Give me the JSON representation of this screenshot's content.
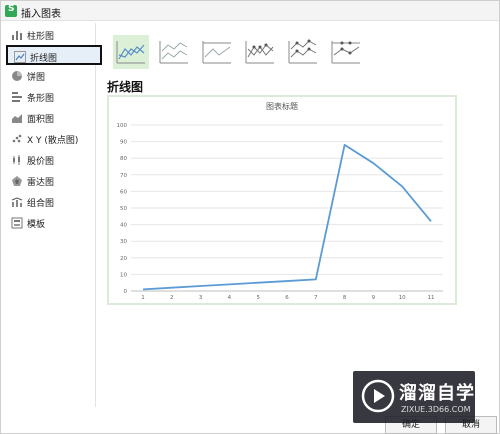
{
  "window": {
    "title": "插入图表"
  },
  "sidebar": {
    "items": [
      {
        "label": "柱形图",
        "icon": "column-chart-icon"
      },
      {
        "label": "折线图",
        "icon": "line-chart-icon",
        "selected": true
      },
      {
        "label": "饼图",
        "icon": "pie-chart-icon"
      },
      {
        "label": "条形图",
        "icon": "bar-chart-icon"
      },
      {
        "label": "面积图",
        "icon": "area-chart-icon"
      },
      {
        "label": "X Y (散点图)",
        "icon": "scatter-chart-icon"
      },
      {
        "label": "股价图",
        "icon": "stock-chart-icon"
      },
      {
        "label": "雷达图",
        "icon": "radar-chart-icon"
      },
      {
        "label": "组合图",
        "icon": "combo-chart-icon"
      },
      {
        "label": "模板",
        "icon": "template-icon"
      }
    ]
  },
  "subtypes": [
    {
      "icon": "line-subtype-icon",
      "active": true
    },
    {
      "icon": "stacked-line-subtype-icon"
    },
    {
      "icon": "percent-stacked-line-subtype-icon"
    },
    {
      "icon": "line-markers-subtype-icon"
    },
    {
      "icon": "stacked-line-markers-subtype-icon"
    },
    {
      "icon": "percent-stacked-line-markers-subtype-icon"
    }
  ],
  "content": {
    "title": "折线图"
  },
  "chart_data": {
    "type": "line",
    "title": "图表标题",
    "x": [
      1,
      2,
      3,
      4,
      5,
      6,
      7,
      8,
      9,
      10,
      11
    ],
    "categories": [
      "1",
      "2",
      "3",
      "4",
      "5",
      "6",
      "7",
      "8",
      "9",
      "10",
      "11"
    ],
    "values": [
      1,
      2,
      3,
      4,
      5,
      6,
      7,
      88,
      77,
      63,
      42
    ],
    "ylim": [
      0,
      100
    ],
    "yticks": [
      0,
      10,
      20,
      30,
      40,
      50,
      60,
      70,
      80,
      90,
      100
    ],
    "grid": true,
    "line_color": "#5b9bd5"
  },
  "buttons": {
    "ok": "确定",
    "cancel": "取消"
  },
  "watermark": {
    "title": "溜溜自学",
    "subtitle": "ZIXUE.3D66.COM"
  },
  "colors": {
    "accent": "#2fa955",
    "selected_bg": "#e6eef8",
    "thumb_active": "#dcf0d8"
  }
}
